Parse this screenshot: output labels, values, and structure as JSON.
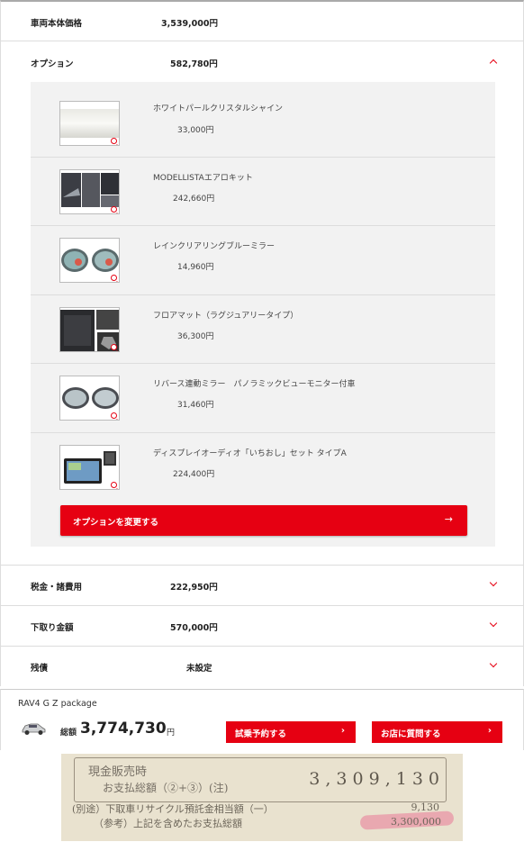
{
  "rows": {
    "body_price": {
      "label": "車両本体価格",
      "value": "3,539,000円"
    },
    "options": {
      "label": "オプション",
      "value": "582,780円"
    },
    "tax": {
      "label": "税金・諸費用",
      "value": "222,950円"
    },
    "tradein": {
      "label": "下取り金額",
      "value": "570,000円"
    },
    "balance": {
      "label": "残債",
      "value": "未設定"
    }
  },
  "options": [
    {
      "name": "ホワイトパールクリスタルシャイン",
      "price": "33,000円"
    },
    {
      "name": "MODELLISTAエアロキット",
      "price": "242,660円"
    },
    {
      "name": "レインクリアリングブルーミラー",
      "price": "14,960円"
    },
    {
      "name": "フロアマット（ラグジュアリータイプ）",
      "price": "36,300円"
    },
    {
      "name": "リバース連動ミラー　パノラミックビューモニター付車",
      "price": "31,460円"
    },
    {
      "name": "ディスプレイオーディオ「いちおし」セット タイプA",
      "price": "224,400円"
    }
  ],
  "change_options_label": "オプションを変更する",
  "arrow_glyph": "→",
  "bottom": {
    "car_name": "RAV4  G Z package",
    "total_label": "総額",
    "total_value": "3,774,730",
    "total_unit": "円",
    "test_drive_label": "試乗予約する",
    "ask_store_label": "お店に質問する",
    "btn_arrow": "›"
  },
  "receipt": {
    "line1": "現金販売時",
    "line2": "お支払総額（②+③）(注)",
    "total": "3,309,130",
    "line3": "(別途）下取車リサイクル預託金相当額（一）",
    "line3_value": "9,130",
    "line4": "（参考）上記を含めたお支払総額",
    "line4_value": "3,300,000"
  },
  "colors": {
    "accent": "#e60012",
    "panel": "#f2f2f2"
  }
}
